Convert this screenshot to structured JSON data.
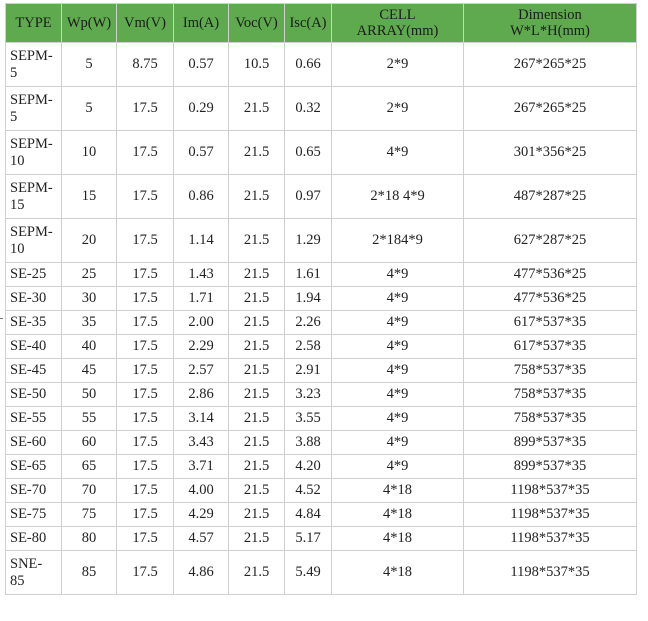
{
  "table": {
    "headers": [
      {
        "line1": "TYPE",
        "line2": ""
      },
      {
        "line1": "Wp(W)",
        "line2": ""
      },
      {
        "line1": "Vm(V)",
        "line2": ""
      },
      {
        "line1": "Im(A)",
        "line2": ""
      },
      {
        "line1": "Voc(V)",
        "line2": ""
      },
      {
        "line1": "Isc(A)",
        "line2": ""
      },
      {
        "line1": "CELL",
        "line2": "ARRAY(mm)"
      },
      {
        "line1": "Dimension",
        "line2": "W*L*H(mm)"
      }
    ],
    "rows": [
      [
        "SEPM-5",
        "5",
        "8.75",
        "0.57",
        "10.5",
        "0.66",
        "2*9",
        "267*265*25"
      ],
      [
        "SEPM-5",
        "5",
        "17.5",
        "0.29",
        "21.5",
        "0.32",
        "2*9",
        "267*265*25"
      ],
      [
        "SEPM-10",
        "10",
        "17.5",
        "0.57",
        "21.5",
        "0.65",
        "4*9",
        "301*356*25"
      ],
      [
        "SEPM-15",
        "15",
        "17.5",
        "0.86",
        "21.5",
        "0.97",
        "2*18 4*9",
        "487*287*25"
      ],
      [
        "SEPM-10",
        "20",
        "17.5",
        "1.14",
        "21.5",
        "1.29",
        "2*184*9",
        "627*287*25"
      ],
      [
        "SE-25",
        "25",
        "17.5",
        "1.43",
        "21.5",
        "1.61",
        "4*9",
        "477*536*25"
      ],
      [
        "SE-30",
        "30",
        "17.5",
        "1.71",
        "21.5",
        "1.94",
        "4*9",
        "477*536*25"
      ],
      [
        "SE-35",
        "35",
        "17.5",
        "2.00",
        "21.5",
        "2.26",
        "4*9",
        "617*537*35"
      ],
      [
        "SE-40",
        "40",
        "17.5",
        "2.29",
        "21.5",
        "2.58",
        "4*9",
        "617*537*35"
      ],
      [
        "SE-45",
        "45",
        "17.5",
        "2.57",
        "21.5",
        "2.91",
        "4*9",
        "758*537*35"
      ],
      [
        "SE-50",
        "50",
        "17.5",
        "2.86",
        "21.5",
        "3.23",
        "4*9",
        "758*537*35"
      ],
      [
        "SE-55",
        "55",
        "17.5",
        "3.14",
        "21.5",
        "3.55",
        "4*9",
        "758*537*35"
      ],
      [
        "SE-60",
        "60",
        "17.5",
        "3.43",
        "21.5",
        "3.88",
        "4*9",
        "899*537*35"
      ],
      [
        "SE-65",
        "65",
        "17.5",
        "3.71",
        "21.5",
        "4.20",
        "4*9",
        "899*537*35"
      ],
      [
        "SE-70",
        "70",
        "17.5",
        "4.00",
        "21.5",
        "4.52",
        "4*18",
        "1198*537*35"
      ],
      [
        "SE-75",
        "75",
        "17.5",
        "4.29",
        "21.5",
        "4.84",
        "4*18",
        "1198*537*35"
      ],
      [
        "SE-80",
        "80",
        "17.5",
        "4.57",
        "21.5",
        "5.17",
        "4*18",
        "1198*537*35"
      ],
      [
        "SNE-85",
        "85",
        "17.5",
        "4.86",
        "21.5",
        "5.49",
        "4*18",
        "1198*537*35"
      ]
    ]
  },
  "colors": {
    "header_background": "#5fa94f",
    "border": "#cfcfcf",
    "text": "#222222"
  }
}
